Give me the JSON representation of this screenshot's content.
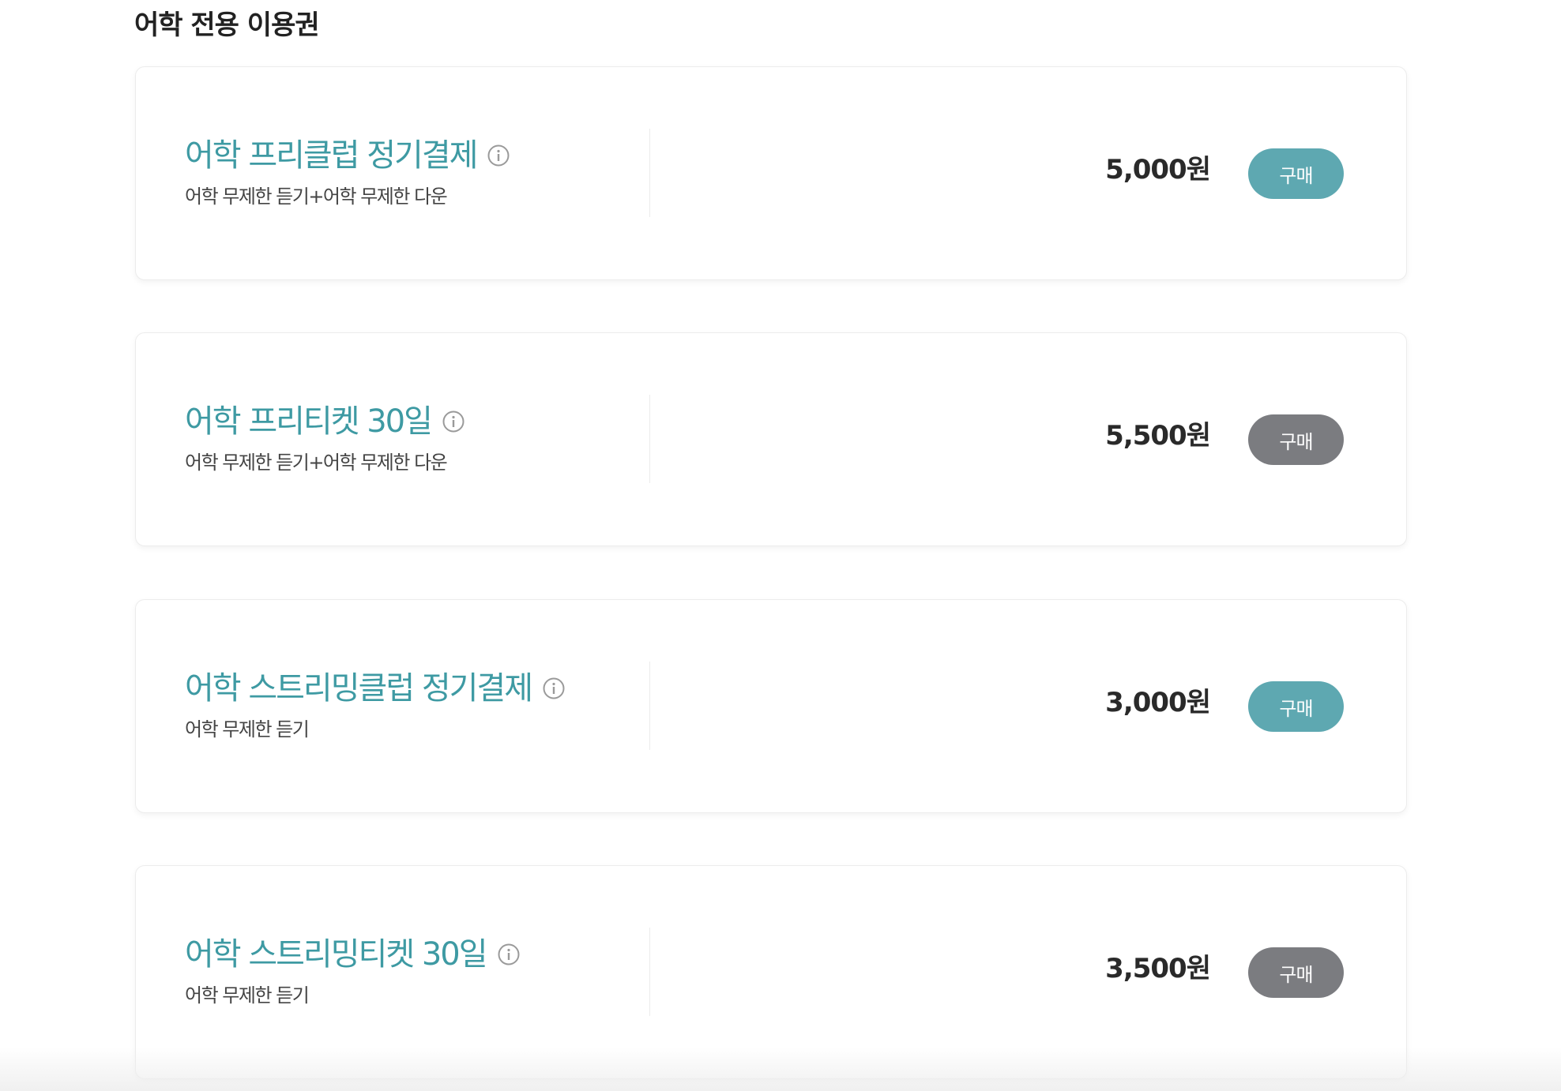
{
  "section": {
    "title": "어학 전용 이용권"
  },
  "plans": [
    {
      "name": "어학 프리클럽 정기결제",
      "desc": "어학 무제한 듣기+어학 무제한 다운",
      "price": "5,000원",
      "button_label": "구매",
      "button_color": "#5ea8b1"
    },
    {
      "name": "어학 프리티켓 30일",
      "desc": "어학 무제한 듣기+어학 무제한 다운",
      "price": "5,500원",
      "button_label": "구매",
      "button_color": "#7b7c80"
    },
    {
      "name": "어학 스트리밍클럽 정기결제",
      "desc": "어학 무제한 듣기",
      "price": "3,000원",
      "button_label": "구매",
      "button_color": "#5ea8b1"
    },
    {
      "name": "어학 스트리밍티켓 30일",
      "desc": "어학 무제한 듣기",
      "price": "3,500원",
      "button_label": "구매",
      "button_color": "#7b7c80"
    }
  ],
  "icons": {
    "info": "info-circle-icon"
  },
  "colors": {
    "plan_name": "#3e9aa3",
    "teal_button": "#5ea8b1",
    "gray_button": "#7b7c80"
  }
}
